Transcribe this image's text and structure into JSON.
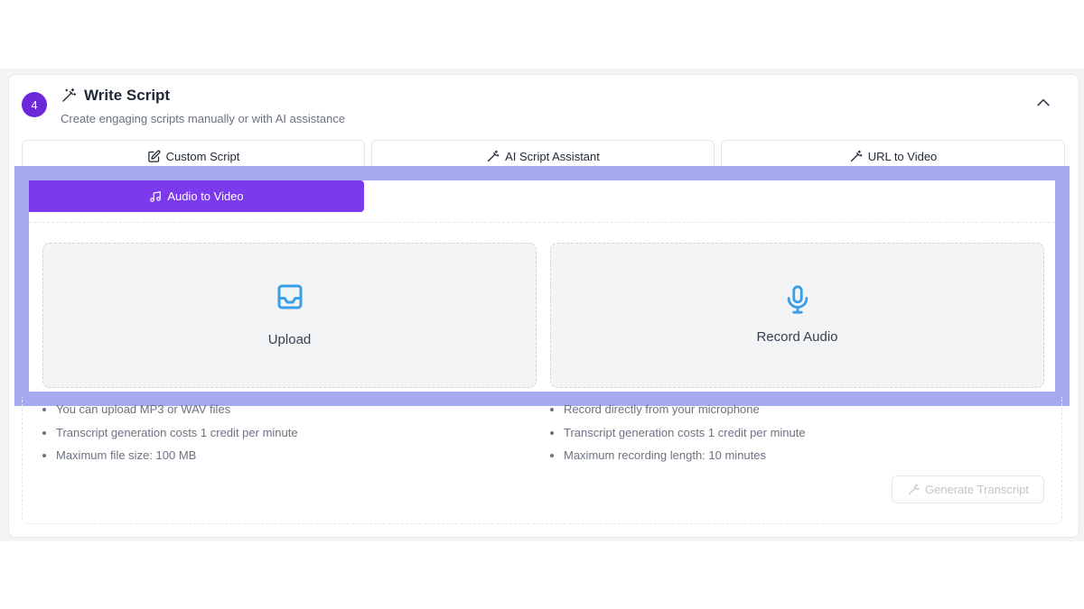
{
  "section": {
    "step_number": "4",
    "title": "Write Script",
    "subtitle": "Create engaging scripts manually or with AI assistance"
  },
  "tabs": [
    {
      "label": "Custom Script",
      "icon": "edit-icon"
    },
    {
      "label": "AI Script Assistant",
      "icon": "magic-wand-icon"
    },
    {
      "label": "URL to Video",
      "icon": "magic-wand-icon"
    }
  ],
  "active_tab": {
    "label": "Audio to Video",
    "icon": "music-note-icon"
  },
  "upload": {
    "label": "Upload",
    "icon": "inbox-icon",
    "notes": [
      "You can upload MP3 or WAV files",
      "Transcript generation costs 1 credit per minute",
      "Maximum file size: 100 MB"
    ]
  },
  "record": {
    "label": "Record Audio",
    "icon": "microphone-icon",
    "notes": [
      "Record directly from your microphone",
      "Transcript generation costs 1 credit per minute",
      "Maximum recording length: 10 minutes"
    ]
  },
  "generate_button": {
    "label": "Generate Transcript",
    "enabled": false
  },
  "colors": {
    "accent_purple": "#7c3aed",
    "badge_purple": "#6d28d9",
    "highlight_border": "#a5a9ef",
    "icon_blue": "#3b9ee8"
  }
}
